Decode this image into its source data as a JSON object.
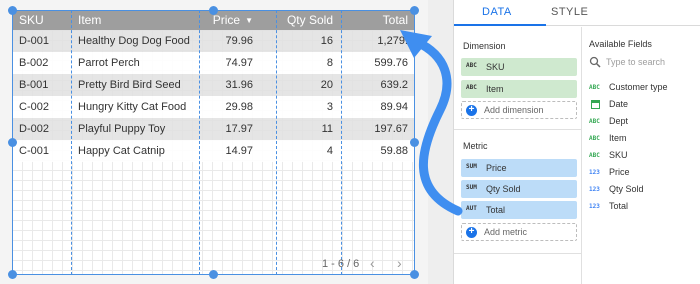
{
  "table": {
    "columns": [
      {
        "key": "sku",
        "label": "SKU"
      },
      {
        "key": "item",
        "label": "Item"
      },
      {
        "key": "price",
        "label": "Price",
        "sort_icon": "caret-down-icon"
      },
      {
        "key": "qty",
        "label": "Qty Sold"
      },
      {
        "key": "total",
        "label": "Total"
      }
    ],
    "rows": [
      {
        "sku": "D-001",
        "item": "Healthy Dog Dog Food",
        "price": "79.96",
        "qty": "16",
        "total": "1,279."
      },
      {
        "sku": "B-002",
        "item": "Parrot Perch",
        "price": "74.97",
        "qty": "8",
        "total": "599.76"
      },
      {
        "sku": "B-001",
        "item": "Pretty Bird Bird Seed",
        "price": "31.96",
        "qty": "20",
        "total": "639.2"
      },
      {
        "sku": "C-002",
        "item": "Hungry Kitty Cat Food",
        "price": "29.98",
        "qty": "3",
        "total": "89.94"
      },
      {
        "sku": "D-002",
        "item": "Playful Puppy Toy",
        "price": "17.97",
        "qty": "11",
        "total": "197.67"
      },
      {
        "sku": "C-001",
        "item": "Happy Cat Catnip",
        "price": "14.97",
        "qty": "4",
        "total": "59.88"
      }
    ],
    "pagination": {
      "label": "1 - 6 / 6",
      "prev": "‹",
      "next": "›"
    }
  },
  "panel": {
    "tabs": [
      {
        "label": "DATA",
        "active": true
      },
      {
        "label": "STYLE",
        "active": false
      }
    ],
    "dimension": {
      "title": "Dimension",
      "chips": [
        {
          "type": "ABC",
          "label": "SKU"
        },
        {
          "type": "ABC",
          "label": "Item"
        }
      ],
      "add_label": "Add dimension"
    },
    "metric": {
      "title": "Metric",
      "chips": [
        {
          "type": "SUM",
          "label": "Price"
        },
        {
          "type": "SUM",
          "label": "Qty Sold"
        },
        {
          "type": "AUT",
          "label": "Total"
        }
      ],
      "add_label": "Add metric"
    },
    "available": {
      "title": "Available Fields",
      "search_placeholder": "Type to search",
      "fields": [
        {
          "type": "ABC",
          "label": "Customer type"
        },
        {
          "type": "date-icon",
          "label": "Date"
        },
        {
          "type": "ABC",
          "label": "Dept"
        },
        {
          "type": "ABC",
          "label": "Item"
        },
        {
          "type": "ABC",
          "label": "SKU"
        },
        {
          "type": "123",
          "label": "Price"
        },
        {
          "type": "123",
          "label": "Qty Sold"
        },
        {
          "type": "123",
          "label": "Total"
        }
      ]
    }
  },
  "colors": {
    "accent": "#1a73e8",
    "selection": "#4a90e2",
    "arrow": "#3f8ef0",
    "header_bg": "#9e9e9e",
    "dimension_chip": "#cfe9cf",
    "metric_chip": "#bcdcf8"
  }
}
